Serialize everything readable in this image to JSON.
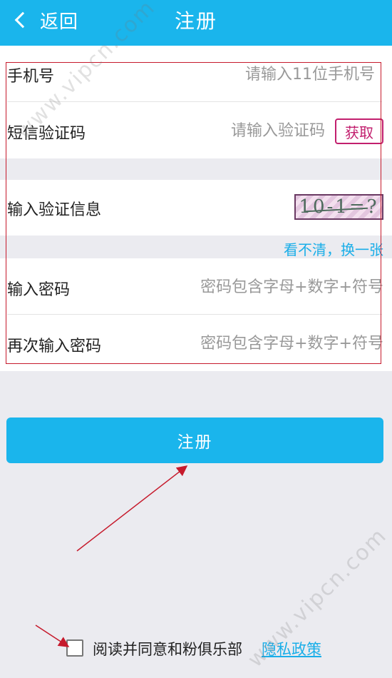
{
  "header": {
    "back_label": "返回",
    "title": "注册"
  },
  "form": {
    "phone": {
      "label": "手机号",
      "placeholder": "请输入11位手机号"
    },
    "sms_code": {
      "label": "短信验证码",
      "placeholder": "请输入验证码",
      "get_button": "获取"
    },
    "captcha": {
      "label": "输入验证信息",
      "image_text": "10-1=?",
      "refresh_link": "看不清，换一张"
    },
    "password": {
      "label": "输入密码",
      "placeholder": "密码包含字母+数字+符号"
    },
    "confirm_password": {
      "label": "再次输入密码",
      "placeholder": "密码包含字母+数字+符号"
    }
  },
  "submit": {
    "label": "注册"
  },
  "agreement": {
    "checked": false,
    "text": "阅读并同意和粉俱乐部",
    "link": "隐私政策"
  },
  "watermark": {
    "text": "www.vipcn.com"
  },
  "colors": {
    "primary": "#1ab5ec",
    "accent": "#c21f6e",
    "annotation": "#c61a2c",
    "link": "#1aaee8"
  }
}
